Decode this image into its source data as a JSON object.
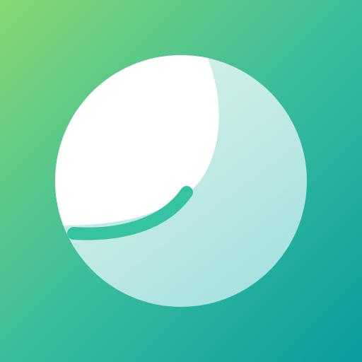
{
  "icon": {
    "name": "sphere-crescent-logo",
    "colors": {
      "gradient_start": "#86d872",
      "gradient_mid": "#3bbd9c",
      "gradient_end": "#089e9f",
      "sphere_light": "#d9f1e9",
      "sphere_shade": "#a8e2e0",
      "crescent": "#ffffff",
      "stroke": "#36c3a1"
    }
  }
}
